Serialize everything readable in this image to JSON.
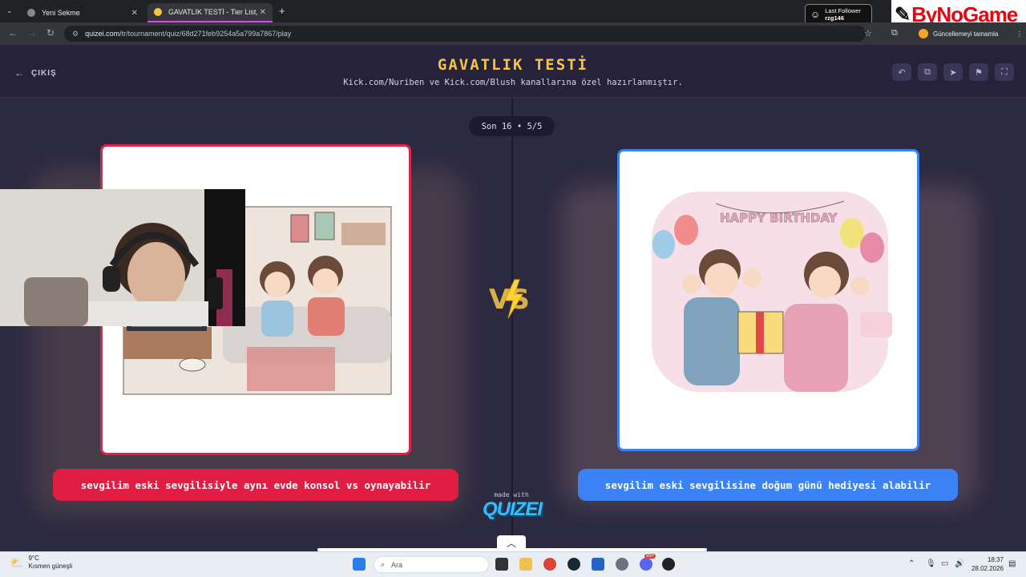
{
  "browser": {
    "tabs": [
      {
        "label": "Yeni Sekme",
        "active": false
      },
      {
        "label": "GAVATLIK TESTİ - Tier List, Kör",
        "active": true
      }
    ],
    "url_host": "quizei.com",
    "url_path": "/tr/tournament/quiz/68d271feb9254a5a799a7867/play",
    "update_label": "Güncellemeyi tamamla"
  },
  "stream_overlay": {
    "follower_title": "Last Follower",
    "follower_name": "rzg146",
    "sponsor": "ByNoGame"
  },
  "header": {
    "exit_label": "ÇIKIŞ",
    "title": "GAVATLIK TESTİ",
    "subtitle": "Kick.com/Nuriben ve Kick.com/Blush kanallarına özel hazırlanmıştır."
  },
  "round": {
    "badge": "Son 16 • 5/5"
  },
  "options": {
    "left": {
      "caption": "sevgilim eski sevgilisiyle aynı evde konsol vs oynayabilir",
      "color": "#e01e43"
    },
    "right": {
      "caption": "sevgilim eski sevgilisine doğum günü hediyesi alabilir",
      "color": "#3b82f6"
    },
    "right_banner": "HAPPY BIRTHDAY"
  },
  "footer": {
    "made_with": "made with",
    "brand": "QUIZEI"
  },
  "taskbar": {
    "temp": "9°C",
    "weather": "Kısmen güneşli",
    "search_label": "Ara",
    "time": "18:37",
    "date": "28.02.2026",
    "notif_badge": "99+"
  }
}
